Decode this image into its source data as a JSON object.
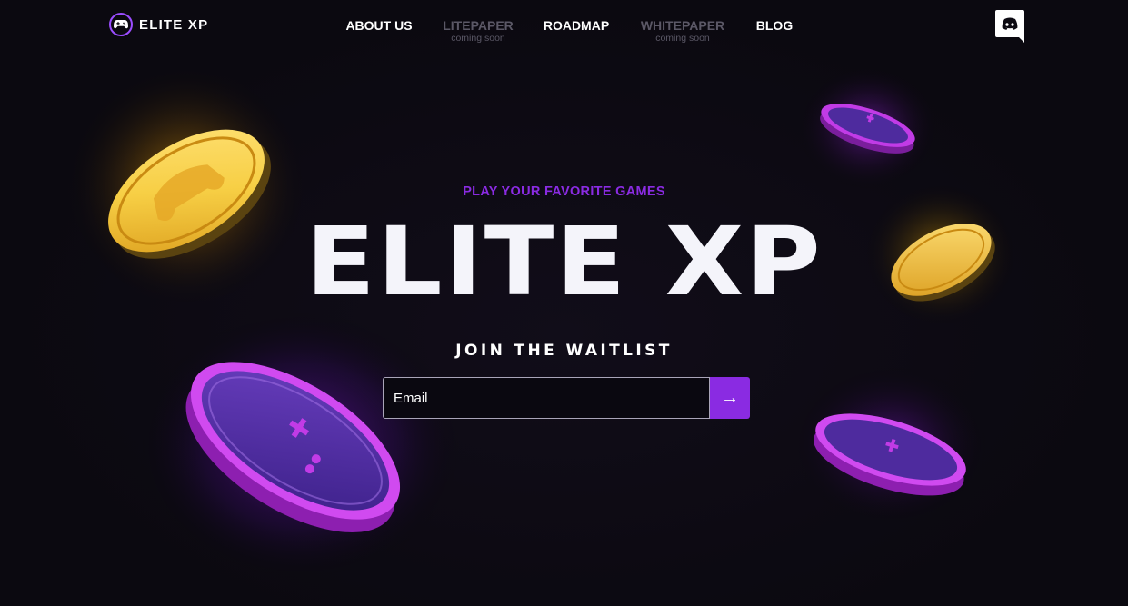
{
  "brand": {
    "name": "ELITE XP",
    "logo_icon": "gamepad-icon",
    "accent_color": "#8a2be2"
  },
  "nav": {
    "items": [
      {
        "label": "ABOUT US",
        "sub": "",
        "enabled": true
      },
      {
        "label": "LITEPAPER",
        "sub": "coming soon",
        "enabled": false
      },
      {
        "label": "ROADMAP",
        "sub": "",
        "enabled": true
      },
      {
        "label": "WHITEPAPER",
        "sub": "coming soon",
        "enabled": false
      },
      {
        "label": "BLOG",
        "sub": "",
        "enabled": true
      }
    ],
    "social_icon": "discord-icon"
  },
  "hero": {
    "tagline": "PLAY YOUR FAVORITE GAMES",
    "title": "ELITE XP",
    "waitlist_heading": "JOIN THE WAITLIST",
    "email_placeholder": "Email",
    "submit_icon": "arrow-right-icon",
    "submit_glyph": "→"
  },
  "decor": {
    "coins": [
      "gold-coin-icon",
      "purple-coin-icon",
      "gold-coin-icon",
      "purple-coin-icon",
      "purple-coin-icon"
    ],
    "gold_color": "#e9b52a",
    "purple_color": "#c12ee0"
  }
}
